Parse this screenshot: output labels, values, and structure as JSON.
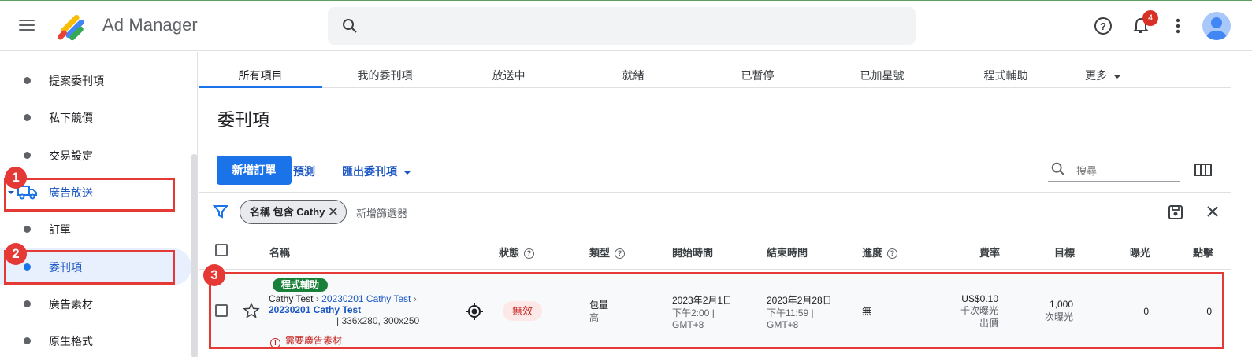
{
  "app": {
    "title": "Ad Manager"
  },
  "header": {
    "search_placeholder": "",
    "notification_count": "4"
  },
  "sidebar": {
    "items": [
      {
        "label": "提案委刊項"
      },
      {
        "label": "私下競價"
      },
      {
        "label": "交易設定"
      },
      {
        "label": "廣告放送"
      },
      {
        "label": "訂單"
      },
      {
        "label": "委刊項"
      },
      {
        "label": "廣告素材"
      },
      {
        "label": "原生格式"
      }
    ]
  },
  "annotations": {
    "m1": "1",
    "m2": "2",
    "m3": "3",
    "color": "#e53935"
  },
  "tabs": [
    {
      "label": "所有項目"
    },
    {
      "label": "我的委刊項"
    },
    {
      "label": "放送中"
    },
    {
      "label": "就緒"
    },
    {
      "label": "已暫停"
    },
    {
      "label": "已加星號"
    },
    {
      "label": "程式輔助"
    },
    {
      "label": "更多"
    }
  ],
  "page": {
    "title": "委刊項"
  },
  "toolbar": {
    "new_order": "新增訂單",
    "forecast": "預測",
    "export": "匯出委刊項",
    "search_placeholder": "搜尋"
  },
  "filter": {
    "chip_label": "名稱 包含 Cathy",
    "chip_remove": "✕",
    "add_filter": "新增篩選器"
  },
  "table": {
    "headers": {
      "name": "名稱",
      "status": "狀態",
      "type": "類型",
      "start": "開始時間",
      "end": "結束時間",
      "progress": "進度",
      "rate": "費率",
      "goal": "目標",
      "impressions": "曝光",
      "clicks": "點擊"
    },
    "rows": [
      {
        "badge": "程式輔助",
        "advertiser": "Cathy Test",
        "order": "20230201 Cathy Test",
        "line_item": "20230201 Cathy Test",
        "sizes": "| 336x280, 300x250",
        "warning": "需要廣告素材",
        "status": "無效",
        "type_line1": "包量",
        "type_line2": "高",
        "start_line1": "2023年2月1日",
        "start_line2": "下午2:00 |",
        "start_line3": "GMT+8",
        "end_line1": "2023年2月28日",
        "end_line2": "下午11:59 |",
        "end_line3": "GMT+8",
        "progress": "無",
        "rate_line1": "US$0.10",
        "rate_line2": "千次曝光",
        "rate_line3": "出價",
        "goal_line1": "1,000",
        "goal_line2": "次曝光",
        "impressions": "0",
        "clicks": "0"
      }
    ]
  },
  "colors": {
    "accent": "#1a73e8",
    "status_invalid": "#c5221f",
    "badge_programmatic": "#188038"
  }
}
